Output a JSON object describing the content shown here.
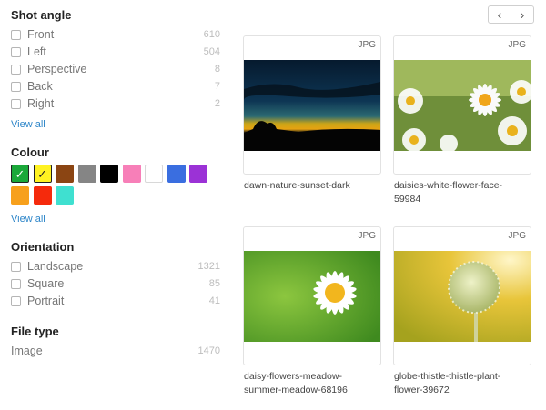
{
  "sidebar": {
    "shot_angle": {
      "title": "Shot angle",
      "items": [
        {
          "label": "Front",
          "count": "610"
        },
        {
          "label": "Left",
          "count": "504"
        },
        {
          "label": "Perspective",
          "count": "8"
        },
        {
          "label": "Back",
          "count": "7"
        },
        {
          "label": "Right",
          "count": "2"
        }
      ],
      "view_all": "View all"
    },
    "colour": {
      "title": "Colour",
      "swatches": [
        {
          "name": "green",
          "hex": "#1aa83a",
          "checked": true
        },
        {
          "name": "yellow",
          "hex": "#fff222",
          "checked": true
        },
        {
          "name": "brown",
          "hex": "#8b4513",
          "checked": false
        },
        {
          "name": "gray",
          "hex": "#858585",
          "checked": false
        },
        {
          "name": "black",
          "hex": "#000000",
          "checked": false
        },
        {
          "name": "pink",
          "hex": "#f77fb8",
          "checked": false
        },
        {
          "name": "white",
          "hex": "#ffffff",
          "checked": false
        },
        {
          "name": "blue",
          "hex": "#3a6ee0",
          "checked": false
        },
        {
          "name": "purple",
          "hex": "#9b32d6",
          "checked": false
        },
        {
          "name": "orange",
          "hex": "#f7a01c",
          "checked": false
        },
        {
          "name": "red",
          "hex": "#f52a0c",
          "checked": false
        },
        {
          "name": "turquoise",
          "hex": "#3fe0d0",
          "checked": false
        }
      ],
      "check_glyph": "✓",
      "view_all": "View all"
    },
    "orientation": {
      "title": "Orientation",
      "items": [
        {
          "label": "Landscape",
          "count": "1321"
        },
        {
          "label": "Square",
          "count": "85"
        },
        {
          "label": "Portrait",
          "count": "41"
        }
      ]
    },
    "file_type": {
      "title": "File type",
      "items": [
        {
          "label": "Image",
          "count": "1470"
        }
      ]
    }
  },
  "pagination": {
    "prev_icon": "chevron-left-icon",
    "prev_glyph": "‹",
    "next_icon": "chevron-right-icon",
    "next_glyph": "›"
  },
  "results": [
    {
      "badge": "JPG",
      "caption_lines": [
        "dawn-nature-sunset-dark"
      ]
    },
    {
      "badge": "JPG",
      "caption_lines": [
        "daisies-white-flower-face-",
        "59984"
      ]
    },
    {
      "badge": "JPG",
      "caption_lines": [
        "daisy-flowers-meadow-",
        "summer-meadow-68196"
      ]
    },
    {
      "badge": "JPG",
      "caption_lines": [
        "globe-thistle-thistle-plant-",
        "flower-39672"
      ]
    }
  ]
}
